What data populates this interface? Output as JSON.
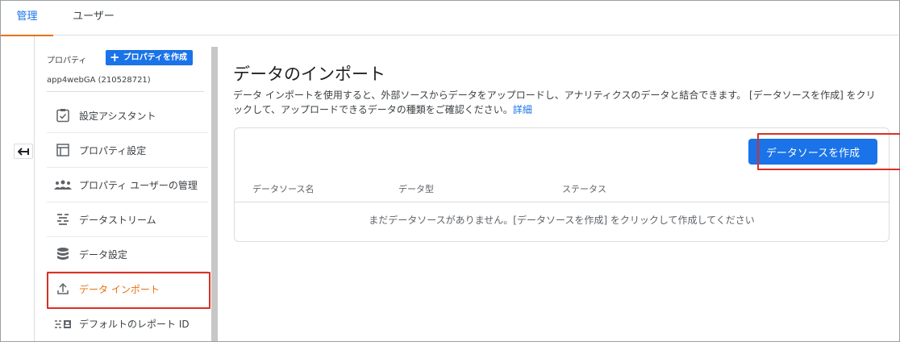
{
  "tabs": [
    {
      "label": "管理"
    },
    {
      "label": "ユーザー"
    }
  ],
  "sidebar": {
    "property_label": "プロパティ",
    "create_property_label": "プロパティを作成",
    "property_name": "app4webGA (210528721)",
    "items": [
      {
        "label": "設定アシスタント",
        "icon": "checklist-icon"
      },
      {
        "label": "プロパティ設定",
        "icon": "layout-icon"
      },
      {
        "label": "プロパティ ユーザーの管理",
        "icon": "people-icon"
      },
      {
        "label": "データストリーム",
        "icon": "streams-icon"
      },
      {
        "label": "データ設定",
        "icon": "database-icon"
      },
      {
        "label": "データ インポート",
        "icon": "upload-icon"
      },
      {
        "label": "デフォルトのレポート ID",
        "icon": "report-id-icon"
      }
    ]
  },
  "main": {
    "title": "データのインポート",
    "description": "データ インポートを使用すると、外部ソースからデータをアップロードし、アナリティクスのデータと結合できます。 [データソースを作成] をクリックして、アップロードできるデータの種類をご確認ください。",
    "details_link": "詳細",
    "create_button": "データソースを作成",
    "columns": [
      "データソース名",
      "データ型",
      "ステータス"
    ],
    "empty_message": "まだデータソースがありません。[データソースを作成] をクリックして作成してください"
  },
  "colors": {
    "accent_blue": "#1a73e8",
    "active_orange": "#e8710a",
    "highlight_red": "#d93025"
  }
}
